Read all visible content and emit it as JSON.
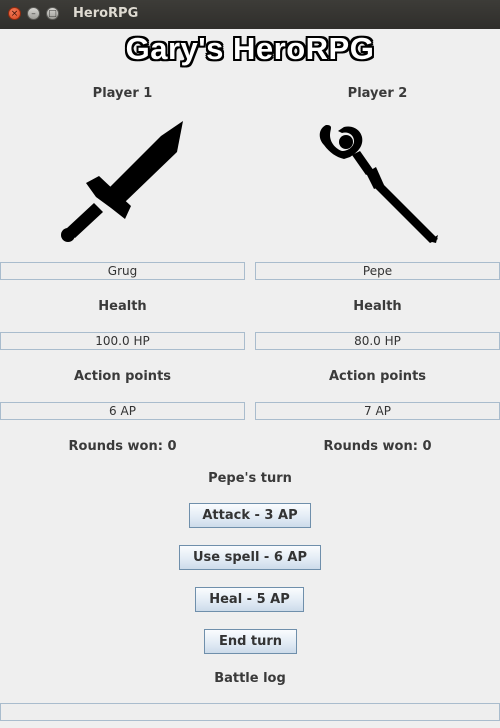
{
  "window": {
    "title": "HeroRPG",
    "close_glyph": "×",
    "min_glyph": "–",
    "max_glyph": "□"
  },
  "app_title": "Gary's HeroRPG",
  "player1": {
    "heading": "Player 1",
    "icon": "sword-icon",
    "name": "Grug",
    "health_label": "Health",
    "health": "100.0 HP",
    "ap_label": "Action points",
    "ap": "6 AP",
    "rounds_won": "Rounds won: 0"
  },
  "player2": {
    "heading": "Player 2",
    "icon": "staff-icon",
    "name": "Pepe",
    "health_label": "Health",
    "health": "80.0 HP",
    "ap_label": "Action points",
    "ap": "7 AP",
    "rounds_won": "Rounds won: 0"
  },
  "turn_status": "Pepe's turn",
  "actions": {
    "attack": "Attack - 3 AP",
    "spell": "Use spell - 6 AP",
    "heal": "Heal - 5 AP",
    "end_turn": "End turn"
  },
  "battle_log": {
    "label": "Battle log",
    "text": ""
  },
  "colors": {
    "titlebar": "#3d3c38",
    "field_border": "#a9bccd",
    "button_border": "#6f8fab",
    "background": "#efefef"
  }
}
